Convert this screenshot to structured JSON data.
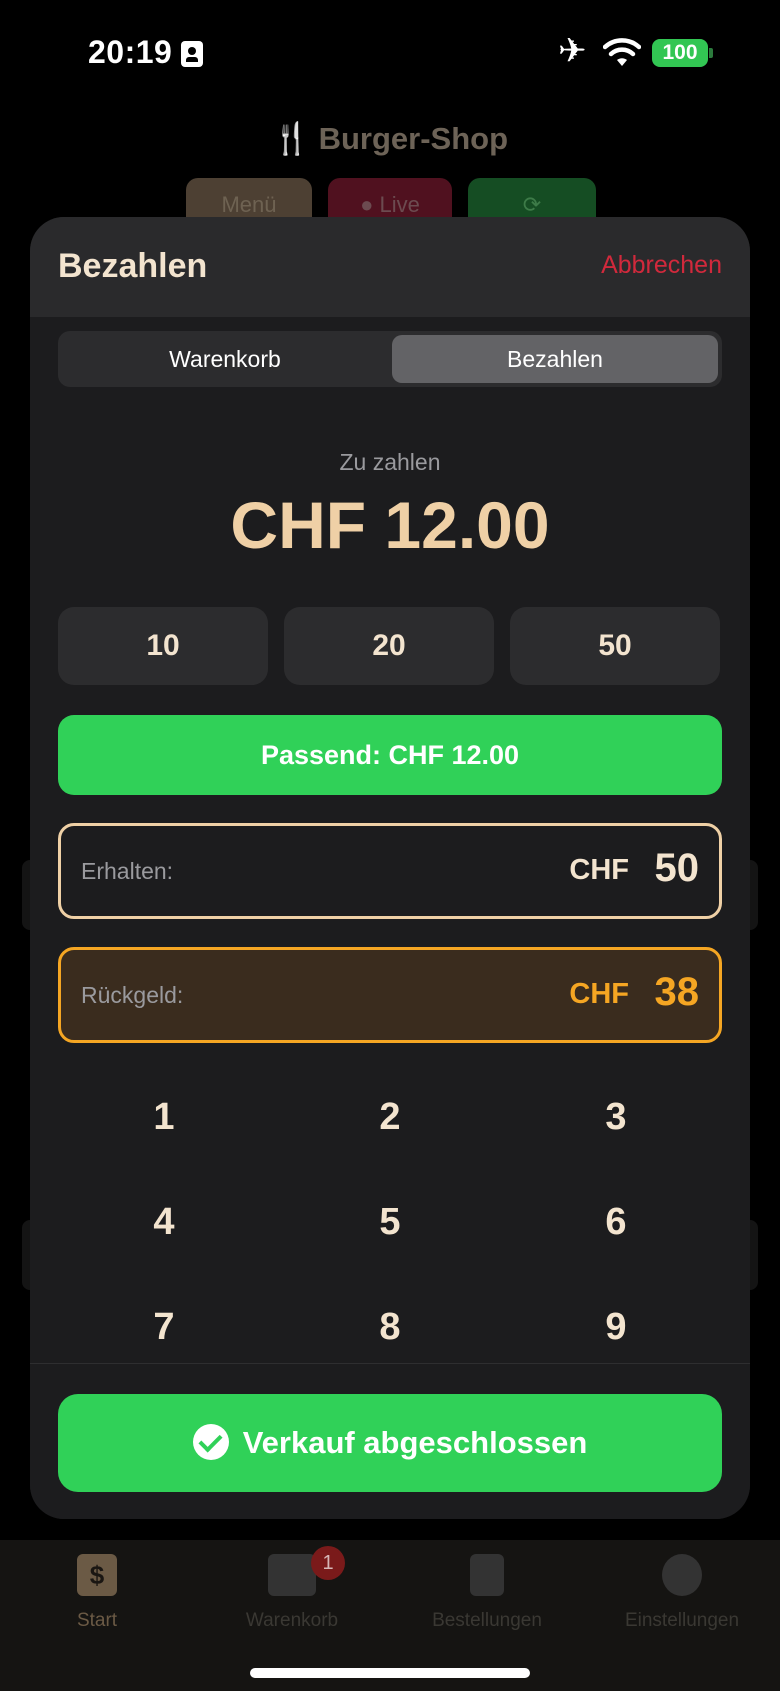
{
  "status_bar": {
    "time": "20:19",
    "battery": "100"
  },
  "background": {
    "title": "Burger-Shop",
    "pills": {
      "menu": "Menü",
      "live": "Live"
    },
    "tabs": [
      {
        "label": "Start",
        "icon": "dollar-icon"
      },
      {
        "label": "Warenkorb",
        "icon": "cart-icon",
        "badge": "1"
      },
      {
        "label": "Bestellungen",
        "icon": "clipboard-icon"
      },
      {
        "label": "Einstellungen",
        "icon": "gear-icon"
      }
    ]
  },
  "sheet": {
    "title": "Bezahlen",
    "cancel": "Abbrechen",
    "segments": [
      "Warenkorb",
      "Bezahlen"
    ],
    "selected_segment": "Bezahlen",
    "due_label": "Zu zahlen",
    "due_amount": "CHF 12.00",
    "quick_amounts": [
      "10",
      "20",
      "50"
    ],
    "exact_button": "Passend: CHF 12.00",
    "received": {
      "label": "Erhalten:",
      "currency": "CHF",
      "value": "50"
    },
    "change": {
      "label": "Rückgeld:",
      "currency": "CHF",
      "value": "38"
    },
    "keypad": [
      "1",
      "2",
      "3",
      "4",
      "5",
      "6",
      "7",
      "8",
      "9"
    ],
    "complete_button": "Verkauf abgeschlossen"
  },
  "colors": {
    "accent": "#efd0a6",
    "success": "#30d158",
    "warning": "#f5a623",
    "danger": "#d1293c"
  }
}
